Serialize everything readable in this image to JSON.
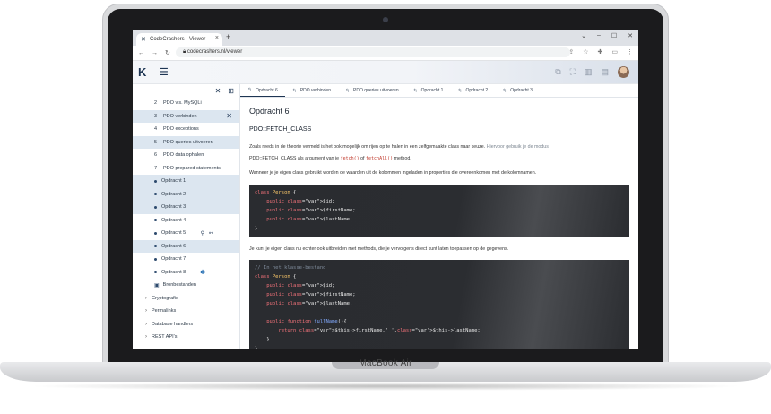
{
  "device_label": "MacBook Air",
  "browser": {
    "tab_title": "CodeCrashers - Viewer",
    "url": "codecrashers.nl/viewer"
  },
  "sidebar": {
    "items": [
      {
        "num": "2",
        "label": "PDO v.s. MySQLi",
        "kind": "numbered",
        "highlight": false
      },
      {
        "num": "3",
        "label": "PDO verbinden",
        "kind": "numbered",
        "highlight": true,
        "close": true
      },
      {
        "num": "4",
        "label": "PDO exceptions",
        "kind": "numbered",
        "highlight": false
      },
      {
        "num": "5",
        "label": "PDO queries uitvoeren",
        "kind": "numbered",
        "highlight": true
      },
      {
        "num": "6",
        "label": "PDO data ophalen",
        "kind": "numbered",
        "highlight": false
      },
      {
        "num": "7",
        "label": "PDO prepared statements",
        "kind": "numbered",
        "highlight": false
      },
      {
        "label": "Opdracht 1",
        "kind": "dot",
        "highlight": true
      },
      {
        "label": "Opdracht 2",
        "kind": "dot",
        "highlight": true
      },
      {
        "label": "Opdracht 3",
        "kind": "dot",
        "highlight": true
      },
      {
        "label": "Opdracht 4",
        "kind": "dot",
        "highlight": false
      },
      {
        "label": "Opdracht 5",
        "kind": "dot",
        "highlight": false,
        "tools": true
      },
      {
        "label": "Opdracht 6",
        "kind": "dot",
        "highlight": true
      },
      {
        "label": "Opdracht 7",
        "kind": "dot",
        "highlight": false
      },
      {
        "label": "Opdracht 8",
        "kind": "dot",
        "highlight": false,
        "gear": true
      },
      {
        "label": "Bronbestanden",
        "kind": "file",
        "highlight": false
      },
      {
        "label": "Cryptografie",
        "kind": "group"
      },
      {
        "label": "Permalinks",
        "kind": "group"
      },
      {
        "label": "Database handlers",
        "kind": "group"
      },
      {
        "label": "REST API's",
        "kind": "group"
      }
    ]
  },
  "content_tabs": [
    "Opdracht 6",
    "PDO verbinden",
    "PDO queries uitvoeren",
    "Opdracht 1",
    "Opdracht 2",
    "Opdracht 3"
  ],
  "article": {
    "title": "Opdracht 6",
    "subtitle": "PDO::FETCH_CLASS",
    "p1_a": "Zoals reeds in de theorie vermeld is het ook mogelijk om rijen op te halen in een zelfgemaakte class naar keuze. ",
    "p1_b": "Hiervoor gebruik je de modus",
    "p2_a": "PDO::FETCH_CLASS als argument van je ",
    "p2_code1": "fetch()",
    "p2_mid": " of ",
    "p2_code2": "fetchAll()",
    "p2_end": " method.",
    "p3": "Wanneer je je eigen class gebruikt worden de waarden uit de kolommen ingeladen in properties die overeenkomen met de kolomnamen.",
    "p4": "Je kunt je eigen class nu echter ook uitbreiden met methods, die je vervolgens direct kunt laten toepassen op de gegevens."
  },
  "code1": [
    "class Person {",
    "    public $id;",
    "    public $firstName;",
    "    public $lastName;",
    "}"
  ],
  "code2": [
    "// In het klasse-bestand",
    "class Person {",
    "    public $id;",
    "    public $firstName;",
    "    public $lastName;",
    "",
    "    public function fullName(){",
    "        return $this->firstName.' '.$this->lastName;",
    "    }",
    "}"
  ]
}
